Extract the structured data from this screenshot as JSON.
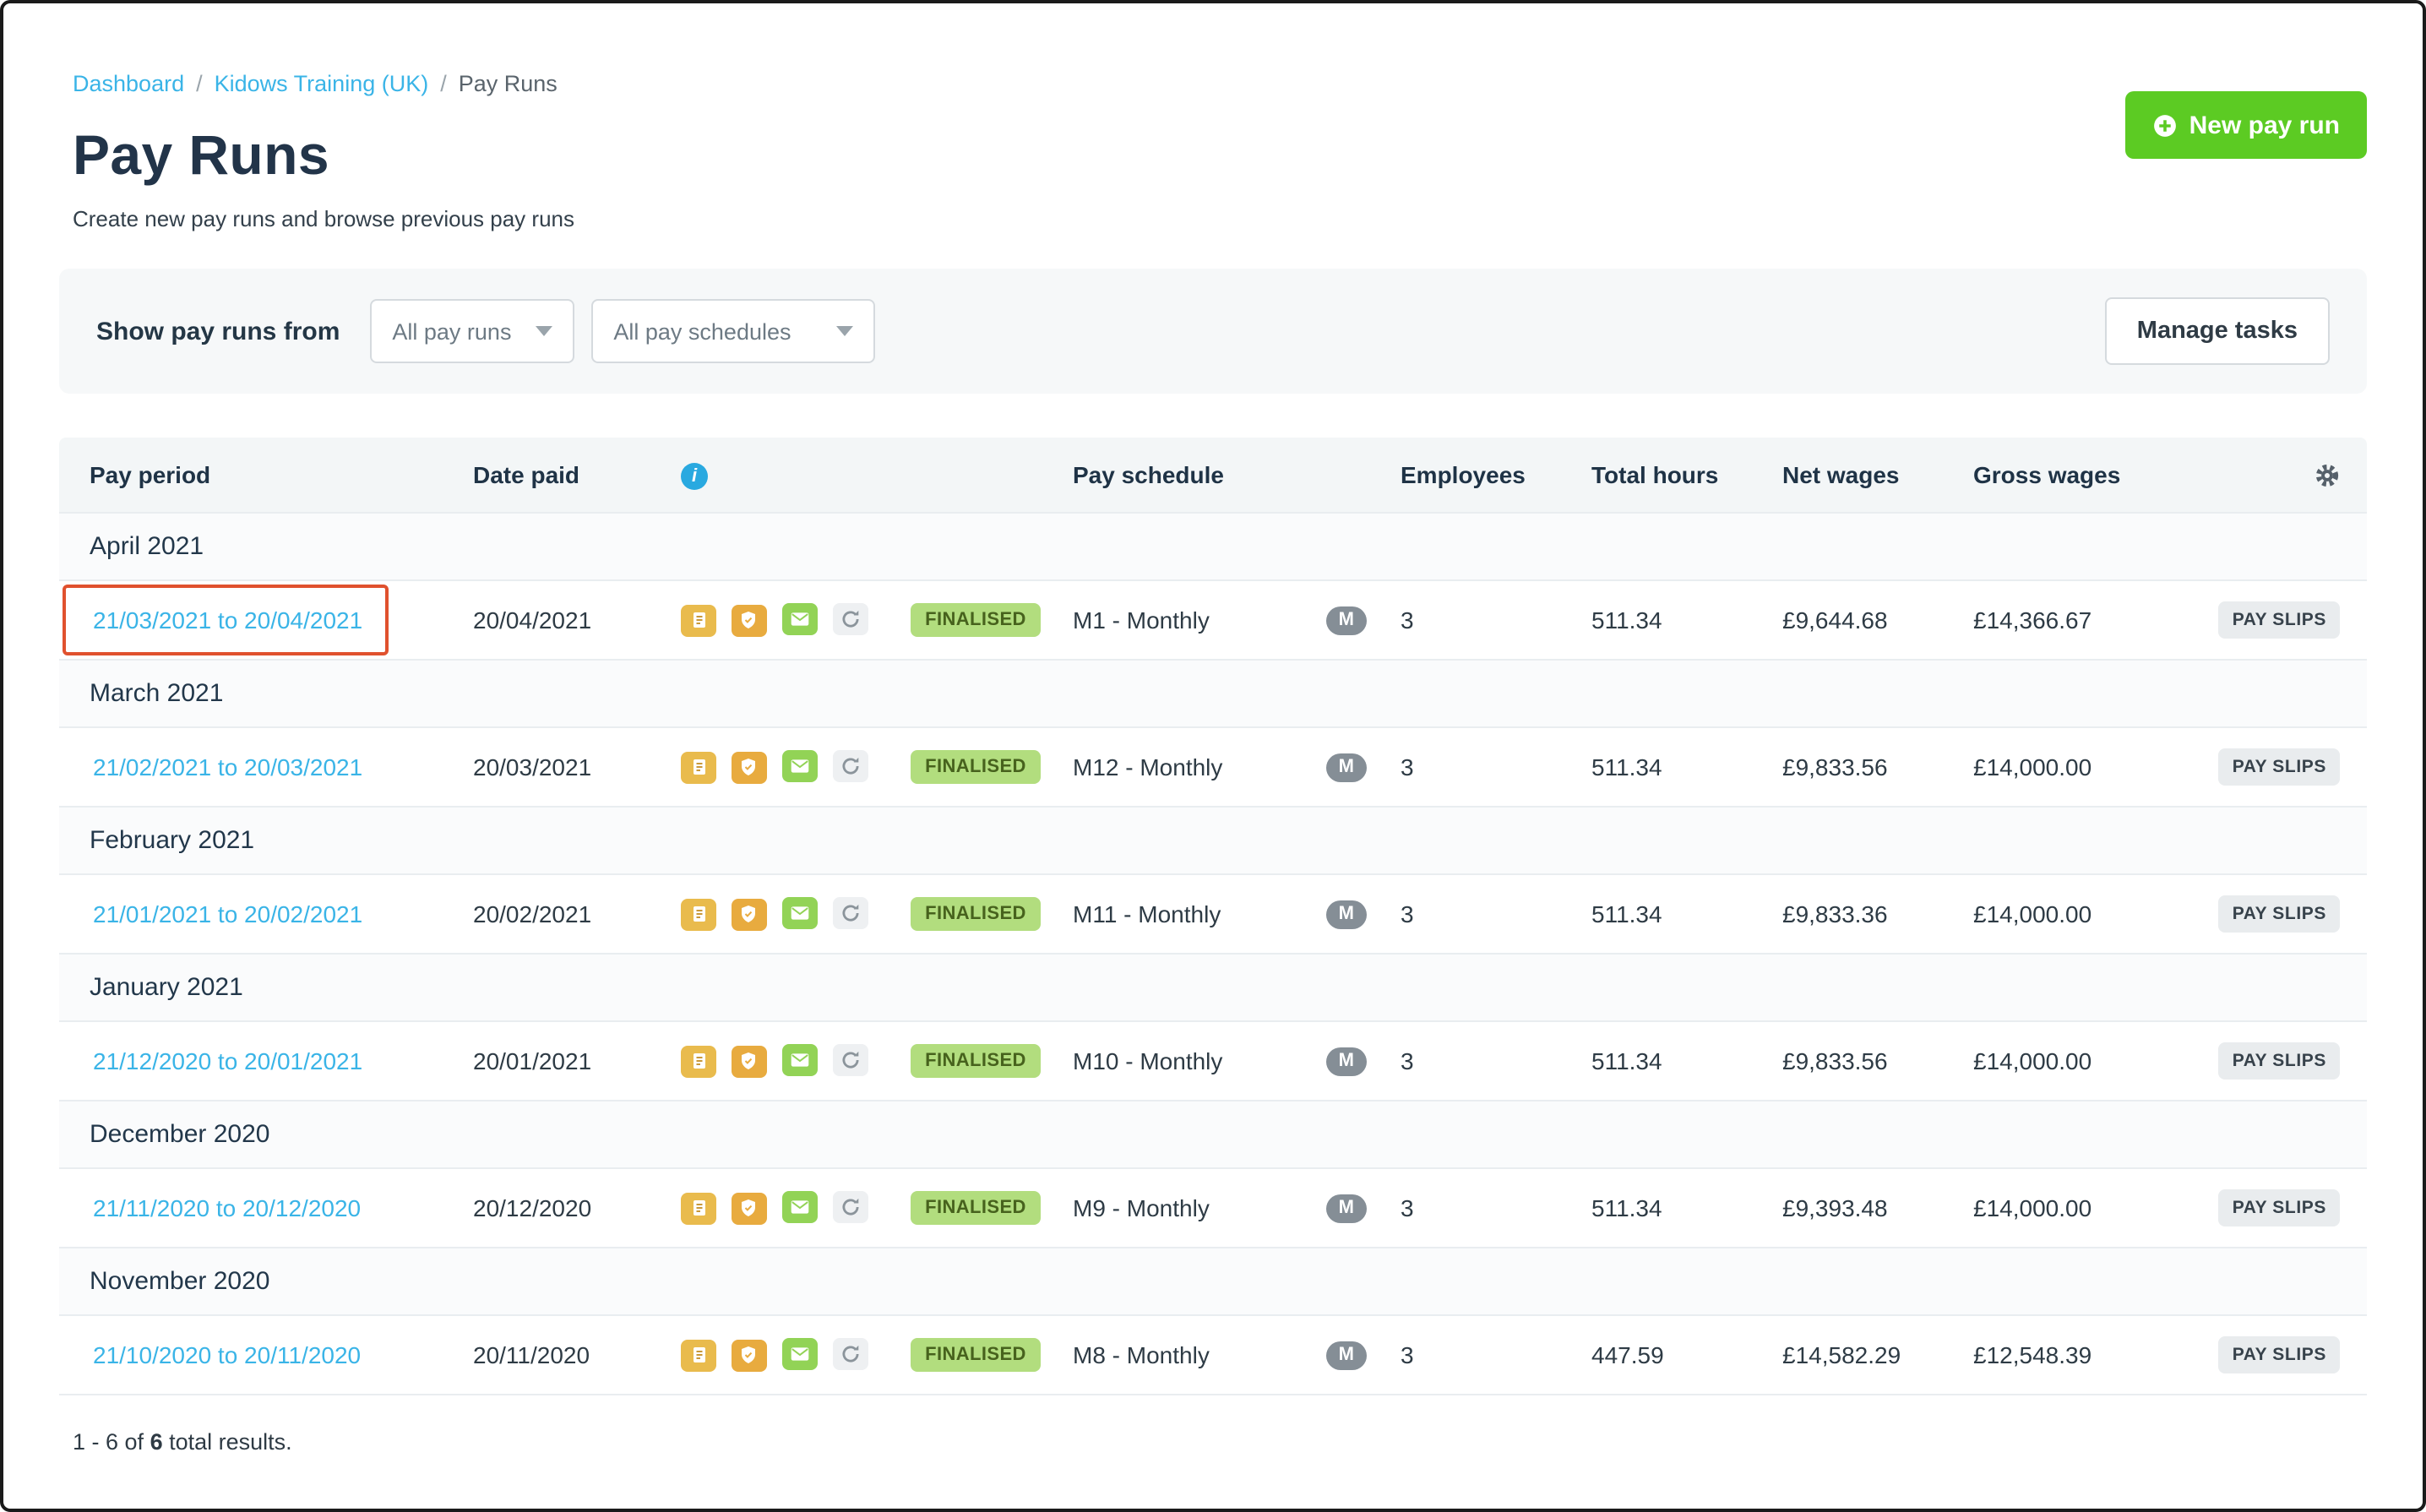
{
  "breadcrumb": {
    "items": [
      {
        "label": "Dashboard"
      },
      {
        "label": "Kidows Training (UK)"
      },
      {
        "label": "Pay Runs"
      }
    ],
    "separator": "/"
  },
  "page": {
    "title": "Pay Runs",
    "subtitle": "Create new pay runs and browse previous pay runs"
  },
  "actions": {
    "new_pay_run": "New pay run",
    "manage_tasks": "Manage tasks"
  },
  "filters": {
    "label": "Show pay runs from",
    "pay_runs_selected": "All pay runs",
    "pay_schedules_selected": "All pay schedules"
  },
  "icons": {
    "new_pay_run": "plus-circle-icon",
    "dropdowns": "chevron-down-icon",
    "header_info": "info-icon",
    "header_settings": "gear-icon",
    "row_icons": [
      "payslip-document-icon",
      "shield-check-icon",
      "envelope-icon",
      "refresh-icon"
    ]
  },
  "colors": {
    "link_blue": "#3ab4e7",
    "accent_green": "#5ccb23",
    "finalised_bg": "#b2dd7e",
    "highlight_red": "#e0512e"
  },
  "table": {
    "columns": {
      "pay_period": "Pay period",
      "date_paid": "Date paid",
      "pay_schedule": "Pay schedule",
      "employees": "Employees",
      "total_hours": "Total hours",
      "net_wages": "Net wages",
      "gross_wages": "Gross wages"
    },
    "payslips_label": "PAY SLIPS",
    "groups": [
      {
        "month": "April 2021",
        "rows": [
          {
            "pay_period": "21/03/2021 to 20/04/2021",
            "date_paid": "20/04/2021",
            "status": "FINALISED",
            "pay_schedule": "M1 - Monthly",
            "schedule_badge": "M",
            "employees": "3",
            "total_hours": "511.34",
            "net_wages": "£9,644.68",
            "gross_wages": "£14,366.67",
            "highlighted": true
          }
        ]
      },
      {
        "month": "March 2021",
        "rows": [
          {
            "pay_period": "21/02/2021 to 20/03/2021",
            "date_paid": "20/03/2021",
            "status": "FINALISED",
            "pay_schedule": "M12 - Monthly",
            "schedule_badge": "M",
            "employees": "3",
            "total_hours": "511.34",
            "net_wages": "£9,833.56",
            "gross_wages": "£14,000.00",
            "highlighted": false
          }
        ]
      },
      {
        "month": "February 2021",
        "rows": [
          {
            "pay_period": "21/01/2021 to 20/02/2021",
            "date_paid": "20/02/2021",
            "status": "FINALISED",
            "pay_schedule": "M11 - Monthly",
            "schedule_badge": "M",
            "employees": "3",
            "total_hours": "511.34",
            "net_wages": "£9,833.36",
            "gross_wages": "£14,000.00",
            "highlighted": false
          }
        ]
      },
      {
        "month": "January 2021",
        "rows": [
          {
            "pay_period": "21/12/2020 to 20/01/2021",
            "date_paid": "20/01/2021",
            "status": "FINALISED",
            "pay_schedule": "M10 - Monthly",
            "schedule_badge": "M",
            "employees": "3",
            "total_hours": "511.34",
            "net_wages": "£9,833.56",
            "gross_wages": "£14,000.00",
            "highlighted": false
          }
        ]
      },
      {
        "month": "December 2020",
        "rows": [
          {
            "pay_period": "21/11/2020 to 20/12/2020",
            "date_paid": "20/12/2020",
            "status": "FINALISED",
            "pay_schedule": "M9 - Monthly",
            "schedule_badge": "M",
            "employees": "3",
            "total_hours": "511.34",
            "net_wages": "£9,393.48",
            "gross_wages": "£14,000.00",
            "highlighted": false
          }
        ]
      },
      {
        "month": "November 2020",
        "rows": [
          {
            "pay_period": "21/10/2020 to 20/11/2020",
            "date_paid": "20/11/2020",
            "status": "FINALISED",
            "pay_schedule": "M8 - Monthly",
            "schedule_badge": "M",
            "employees": "3",
            "total_hours": "447.59",
            "net_wages": "£14,582.29",
            "gross_wages": "£12,548.39",
            "highlighted": false
          }
        ]
      }
    ]
  },
  "footer": {
    "range_prefix": "1 - 6 of",
    "total_count": "6",
    "suffix": " total results."
  }
}
